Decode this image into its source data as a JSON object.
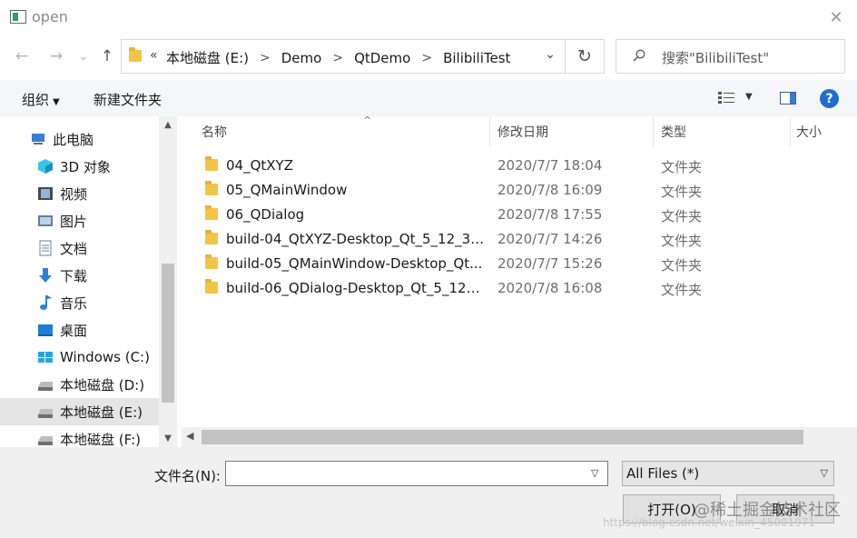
{
  "window": {
    "title": "open",
    "close_glyph": "✕"
  },
  "navigation": {
    "back_glyph": "←",
    "forward_glyph": "→",
    "recent_glyph": "⌄",
    "up_glyph": "↑",
    "refresh_glyph": "↻"
  },
  "address": {
    "overflow": "«",
    "separator": ">",
    "crumbs": [
      "本地磁盘 (E:)",
      "Demo",
      "QtDemo",
      "BilibiliTest"
    ],
    "dropdown_glyph": "⌄"
  },
  "search": {
    "placeholder": "搜索\"BilibiliTest\""
  },
  "toolbar": {
    "organize": "组织",
    "new_folder": "新建文件夹",
    "help": "?"
  },
  "sidebar": {
    "items": [
      {
        "label": "此电脑",
        "icon": "computer-icon"
      },
      {
        "label": "3D 对象",
        "icon": "3d-objects-icon"
      },
      {
        "label": "视频",
        "icon": "video-icon"
      },
      {
        "label": "图片",
        "icon": "pictures-icon"
      },
      {
        "label": "文档",
        "icon": "documents-icon"
      },
      {
        "label": "下载",
        "icon": "downloads-icon"
      },
      {
        "label": "音乐",
        "icon": "music-icon"
      },
      {
        "label": "桌面",
        "icon": "desktop-icon"
      },
      {
        "label": "Windows (C:)",
        "icon": "windows-drive-icon"
      },
      {
        "label": "本地磁盘 (D:)",
        "icon": "drive-icon"
      },
      {
        "label": "本地磁盘 (E:)",
        "icon": "drive-icon",
        "selected": true
      },
      {
        "label": "本地磁盘 (F:)",
        "icon": "drive-icon"
      }
    ]
  },
  "columns": {
    "name": "名称",
    "date": "修改日期",
    "type": "类型",
    "size": "大小"
  },
  "files": [
    {
      "name": "04_QtXYZ",
      "date": "2020/7/7 18:04",
      "type": "文件夹"
    },
    {
      "name": "05_QMainWindow",
      "date": "2020/7/8 16:09",
      "type": "文件夹"
    },
    {
      "name": "06_QDialog",
      "date": "2020/7/8 17:55",
      "type": "文件夹"
    },
    {
      "name": "build-04_QtXYZ-Desktop_Qt_5_12_3_...",
      "date": "2020/7/7 14:26",
      "type": "文件夹"
    },
    {
      "name": "build-05_QMainWindow-Desktop_Qt...",
      "date": "2020/7/7 15:26",
      "type": "文件夹"
    },
    {
      "name": "build-06_QDialog-Desktop_Qt_5_12_...",
      "date": "2020/7/8 16:08",
      "type": "文件夹"
    }
  ],
  "footer": {
    "filename_label": "文件名(N):",
    "filename_value": "",
    "filter_value": "All Files  (*)",
    "open_button": "打开(O)",
    "cancel_button": "取消"
  },
  "watermark": {
    "brand": "@稀土掘金技术社区",
    "url": "https://blog.csdn.net/weixin_45001971"
  },
  "colors": {
    "accent": "#1f6fd0",
    "folder": "#f3c547",
    "selected_bg": "#e5e5e5",
    "toolbar_bg": "#f5f6f7"
  }
}
